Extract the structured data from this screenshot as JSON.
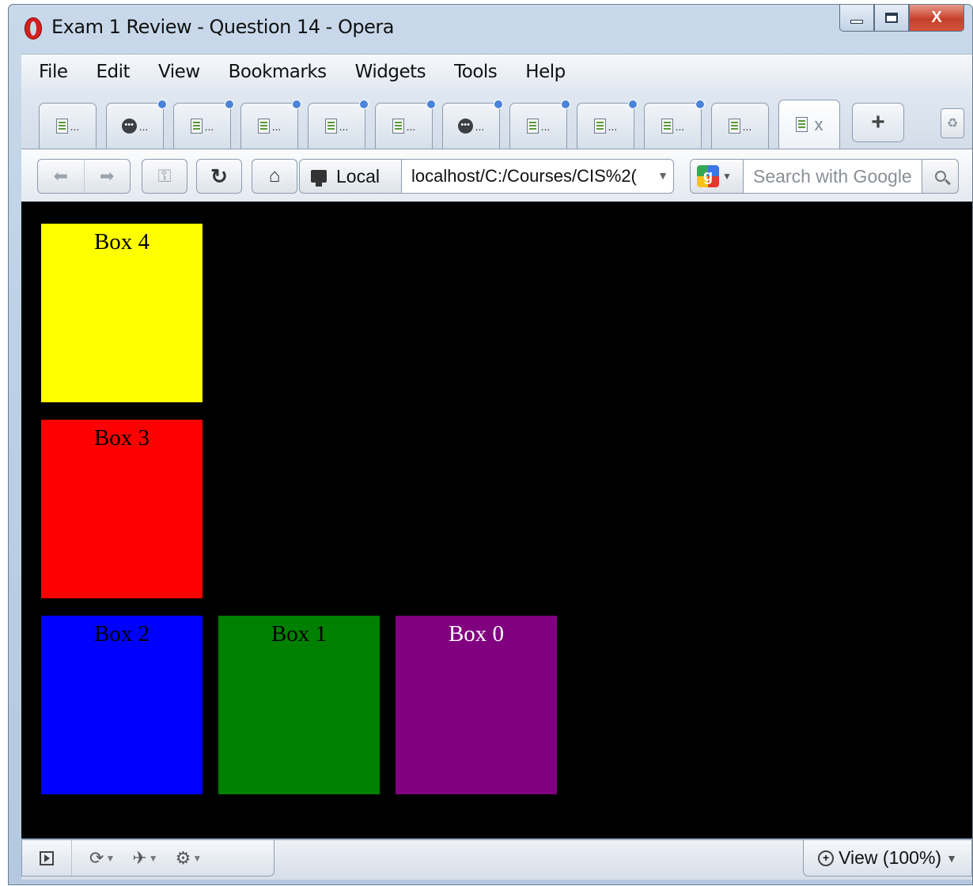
{
  "window": {
    "title": "Exam 1 Review - Question 14 - Opera",
    "minimize_icon": "minimize-icon",
    "maximize_icon": "maximize-icon",
    "close_label": "X"
  },
  "menu": [
    "File",
    "Edit",
    "View",
    "Bookmarks",
    "Widgets",
    "Tools",
    "Help"
  ],
  "tabs": [
    {
      "label": "...",
      "icon": "page-icon",
      "dot": false
    },
    {
      "label": "...",
      "icon": "opera-icon",
      "dot": true
    },
    {
      "label": "...",
      "icon": "page-icon",
      "dot": true
    },
    {
      "label": "...",
      "icon": "page-icon",
      "dot": true
    },
    {
      "label": "...",
      "icon": "page-icon",
      "dot": true
    },
    {
      "label": "...",
      "icon": "page-icon",
      "dot": true
    },
    {
      "label": "...",
      "icon": "opera-icon",
      "dot": true
    },
    {
      "label": "...",
      "icon": "page-icon",
      "dot": true
    },
    {
      "label": "...",
      "icon": "page-icon",
      "dot": true
    },
    {
      "label": "...",
      "icon": "page-icon",
      "dot": true
    },
    {
      "label": "...",
      "icon": "page-icon",
      "dot": false
    }
  ],
  "active_tab": {
    "close_label": "x"
  },
  "new_tab_label": "+",
  "nav": {
    "back_icon": "back-arrow-icon",
    "forward_icon": "forward-arrow-icon",
    "wand_icon": "key-icon",
    "reload_icon": "reload-icon",
    "home_icon": "home-icon",
    "local_label": "Local",
    "address": "localhost/C:/Courses/CIS%2(",
    "search_placeholder": "Search with Google"
  },
  "page": {
    "background": "#000000",
    "boxes": [
      {
        "label": "Box 4",
        "color": "#ffff00",
        "text_color": "#000000"
      },
      {
        "label": "Box 3",
        "color": "#ff0000",
        "text_color": "#000000"
      },
      {
        "label": "Box 2",
        "color": "#0000ff",
        "text_color": "#000000"
      },
      {
        "label": "Box 1",
        "color": "#008000",
        "text_color": "#000000"
      },
      {
        "label": "Box 0",
        "color": "#800080",
        "text_color": "#ffffff"
      }
    ]
  },
  "status": {
    "view_label": "View (100%)"
  }
}
